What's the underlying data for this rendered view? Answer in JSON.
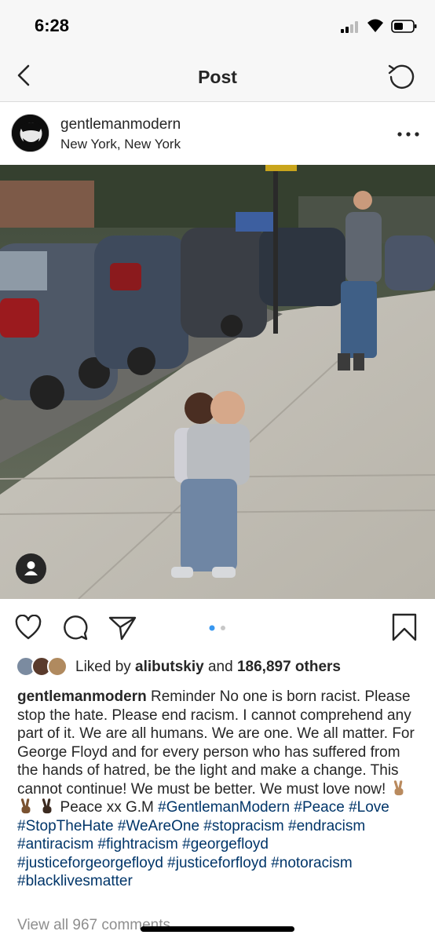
{
  "status_bar": {
    "time": "6:28"
  },
  "nav": {
    "title": "Post",
    "back_icon": "chevron-left-icon",
    "refresh_icon": "refresh-icon"
  },
  "post": {
    "username": "gentlemanmodern",
    "location": "New York, New York",
    "likes": {
      "prefix": "Liked by ",
      "liker": "alibutskiy",
      "middle": " and ",
      "count": "186,897 others"
    },
    "caption": {
      "username": "gentlemanmodern",
      "text": " Reminder No one is born racist. Please stop the hate. Please end racism. I cannot comprehend any part of it. We are all humans. We are one. We all matter. For George Floyd and for every person who has suffered from the hands of hatred, be the light and make a change. This cannot continue! We must be better. We must love now! ",
      "peace_text": " Peace xx G.M ",
      "hashtags": [
        "#GentlemanModern",
        "#Peace",
        "#Love",
        "#StopTheHate",
        " #WeAreOne",
        "#stopracism",
        "#endracism",
        "#antiracism",
        "#fightracism",
        "#georgefloyd",
        "#justiceforgeorgefloyd",
        "#justiceforfloyd",
        "#notoracism",
        "#blacklivesmatter"
      ]
    },
    "view_all_comments": "View all 967 comments",
    "carousel": {
      "current": 1,
      "total": 2
    }
  },
  "colors": {
    "hashtag": "#003569",
    "accent_dot": "#3897f0",
    "muted": "#8e8e8e"
  }
}
